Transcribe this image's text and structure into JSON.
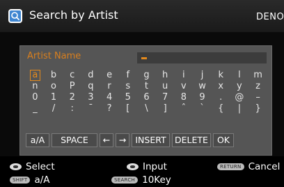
{
  "header": {
    "title": "Search by Artist",
    "brand": "DENON",
    "icon": "search-mode-icon"
  },
  "field": {
    "label": "Artist Name",
    "value": ""
  },
  "keyboard": {
    "selected_index": 0,
    "rows": [
      [
        "a",
        "b",
        "c",
        "d",
        "e",
        "f",
        "g",
        "h",
        "i",
        "j",
        "k",
        "l",
        "m"
      ],
      [
        "n",
        "o",
        "P",
        "q",
        "r",
        "s",
        "t",
        "u",
        "v",
        "w",
        "x",
        "y",
        "z"
      ],
      [
        "0",
        "1",
        "2",
        "3",
        "4",
        "5",
        "6",
        "7",
        "8",
        "9",
        ".",
        "@",
        "–"
      ],
      [
        "_",
        "/",
        ":",
        "¯",
        "?",
        "[",
        "\\",
        "]",
        "ˆ",
        "`",
        "{",
        "|",
        "}"
      ]
    ],
    "controls": [
      "a/A",
      "SPACE",
      "←",
      "→",
      "INSERT",
      "DELETE",
      "OK"
    ]
  },
  "footer": {
    "select_label": "Select",
    "input_label": "Input",
    "return_tag": "RETURN",
    "cancel_label": "Cancel",
    "shift_tag": "SHIFT",
    "shift_label": "a/A",
    "search_tag": "SEARCH",
    "search_label": "10Key"
  },
  "colors": {
    "accent": "#e58a1c",
    "panel": "#555555",
    "header_icon": "#3f86d1"
  }
}
